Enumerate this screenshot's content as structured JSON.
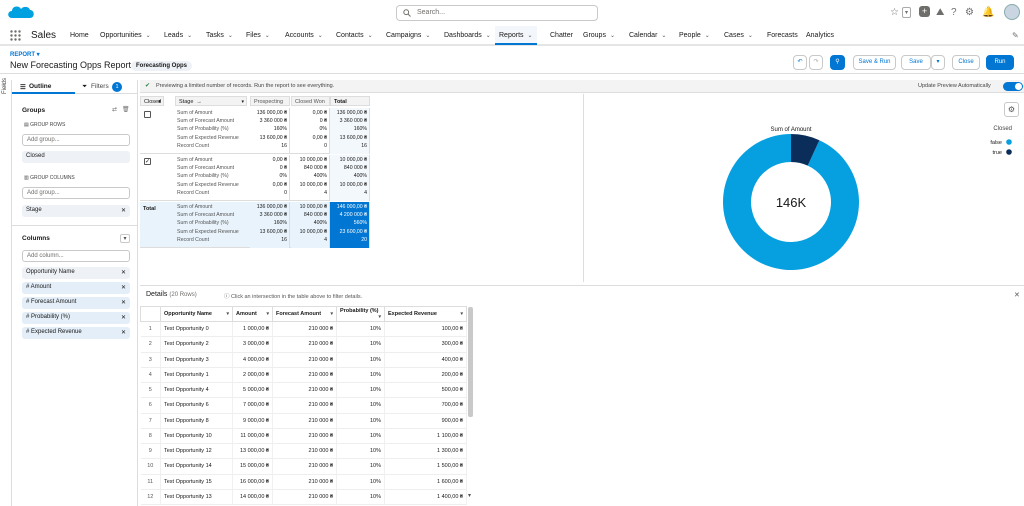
{
  "app": {
    "name": "Sales",
    "search_placeholder": "Search..."
  },
  "nav": [
    {
      "label": "Home",
      "chevron": false
    },
    {
      "label": "Opportunities",
      "chevron": true
    },
    {
      "label": "Leads",
      "chevron": true
    },
    {
      "label": "Tasks",
      "chevron": true
    },
    {
      "label": "Files",
      "chevron": true
    },
    {
      "label": "Accounts",
      "chevron": true
    },
    {
      "label": "Contacts",
      "chevron": true
    },
    {
      "label": "Campaigns",
      "chevron": true
    },
    {
      "label": "Dashboards",
      "chevron": true
    },
    {
      "label": "Reports",
      "chevron": true,
      "active": true
    },
    {
      "label": "Chatter",
      "chevron": false
    },
    {
      "label": "Groups",
      "chevron": true
    },
    {
      "label": "Calendar",
      "chevron": true
    },
    {
      "label": "People",
      "chevron": true
    },
    {
      "label": "Cases",
      "chevron": true
    },
    {
      "label": "Forecasts",
      "chevron": false
    },
    {
      "label": "Analytics",
      "chevron": false
    }
  ],
  "report": {
    "label": "REPORT",
    "title": "New Forecasting Opps Report",
    "type_badge": "Forecasting Opps",
    "buttons": {
      "save_run": "Save & Run",
      "save": "Save",
      "close": "Close",
      "run": "Run"
    }
  },
  "sidepanel": {
    "fields_label": "Fields",
    "tab_outline": "Outline",
    "tab_filters": "Filters",
    "filters_count": "1",
    "groups_title": "Groups",
    "group_rows_label": "GROUP ROWS",
    "add_group_placeholder": "Add group...",
    "group_rows": [
      "Closed"
    ],
    "group_columns_label": "GROUP COLUMNS",
    "group_columns": [
      "Stage"
    ],
    "columns_title": "Columns",
    "add_column_placeholder": "Add column...",
    "columns": [
      {
        "label": "Opportunity Name"
      },
      {
        "label": "# Amount"
      },
      {
        "label": "# Forecast Amount"
      },
      {
        "label": "# Probability (%)"
      },
      {
        "label": "# Expected Revenue"
      }
    ]
  },
  "banner": {
    "message": "Previewing a limited number of records. Run the report to see everything.",
    "update_preview": "Update Preview Automatically"
  },
  "matrix": {
    "row_header": "Closed",
    "col_header": "Stage",
    "arrow": "→",
    "columns": [
      "Prospecting",
      "Closed Won",
      "Total"
    ],
    "measures": [
      "Sum of Amount",
      "Sum of Forecast Amount",
      "Sum of Probability (%)",
      "Sum of Expected Revenue",
      "Record Count"
    ],
    "rows": [
      {
        "group": "false",
        "cells": [
          [
            "136 000,00 ₴",
            "3 360 000 ₴",
            "160%",
            "13 600,00 ₴",
            "16"
          ],
          [
            "0,00 ₴",
            "0 ₴",
            "0%",
            "0,00 ₴",
            "0"
          ],
          [
            "136 000,00 ₴",
            "3 360 000 ₴",
            "160%",
            "13 600,00 ₴",
            "16"
          ]
        ]
      },
      {
        "group": "true",
        "cells": [
          [
            "0,00 ₴",
            "0 ₴",
            "0%",
            "0,00 ₴",
            "0"
          ],
          [
            "10 000,00 ₴",
            "840 000 ₴",
            "400%",
            "10 000,00 ₴",
            "4"
          ],
          [
            "10 000,00 ₴",
            "840 000 ₴",
            "400%",
            "10 000,00 ₴",
            "4"
          ]
        ]
      },
      {
        "group": "Total",
        "cells": [
          [
            "136 000,00 ₴",
            "3 360 000 ₴",
            "160%",
            "13 600,00 ₴",
            "16"
          ],
          [
            "10 000,00 ₴",
            "840 000 ₴",
            "400%",
            "10 000,00 ₴",
            "4"
          ],
          [
            "146 000,00 ₴",
            "4 200 000 ₴",
            "560%",
            "23 600,00 ₴",
            "20"
          ]
        ]
      }
    ]
  },
  "chart_data": {
    "type": "pie",
    "title": "Sum of Amount",
    "center_label": "146K",
    "legend_title": "Closed",
    "legend_position": "right",
    "categories": [
      "false",
      "true"
    ],
    "values": [
      136000,
      10000
    ],
    "colors": [
      "#069fe0",
      "#0b2d5a"
    ]
  },
  "details": {
    "title": "Details",
    "rows_count": "(20 Rows)",
    "hint": "Click an intersection in the table above to filter details.",
    "headers": [
      "Opportunity Name",
      "Amount",
      "Forecast Amount",
      "Probability (%)",
      "Expected Revenue"
    ],
    "rows": [
      [
        "1",
        "Test Opportunity 0",
        "1 000,00 ₴",
        "210 000 ₴",
        "10%",
        "100,00 ₴"
      ],
      [
        "2",
        "Test Opportunity 2",
        "3 000,00 ₴",
        "210 000 ₴",
        "10%",
        "300,00 ₴"
      ],
      [
        "3",
        "Test Opportunity 3",
        "4 000,00 ₴",
        "210 000 ₴",
        "10%",
        "400,00 ₴"
      ],
      [
        "4",
        "Test Opportunity 1",
        "2 000,00 ₴",
        "210 000 ₴",
        "10%",
        "200,00 ₴"
      ],
      [
        "5",
        "Test Opportunity 4",
        "5 000,00 ₴",
        "210 000 ₴",
        "10%",
        "500,00 ₴"
      ],
      [
        "6",
        "Test Opportunity 6",
        "7 000,00 ₴",
        "210 000 ₴",
        "10%",
        "700,00 ₴"
      ],
      [
        "7",
        "Test Opportunity 8",
        "9 000,00 ₴",
        "210 000 ₴",
        "10%",
        "900,00 ₴"
      ],
      [
        "8",
        "Test Opportunity 10",
        "11 000,00 ₴",
        "210 000 ₴",
        "10%",
        "1 100,00 ₴"
      ],
      [
        "9",
        "Test Opportunity 12",
        "13 000,00 ₴",
        "210 000 ₴",
        "10%",
        "1 300,00 ₴"
      ],
      [
        "10",
        "Test Opportunity 14",
        "15 000,00 ₴",
        "210 000 ₴",
        "10%",
        "1 500,00 ₴"
      ],
      [
        "11",
        "Test Opportunity 15",
        "16 000,00 ₴",
        "210 000 ₴",
        "10%",
        "1 600,00 ₴"
      ],
      [
        "12",
        "Test Opportunity 13",
        "14 000,00 ₴",
        "210 000 ₴",
        "10%",
        "1 400,00 ₴"
      ]
    ]
  }
}
